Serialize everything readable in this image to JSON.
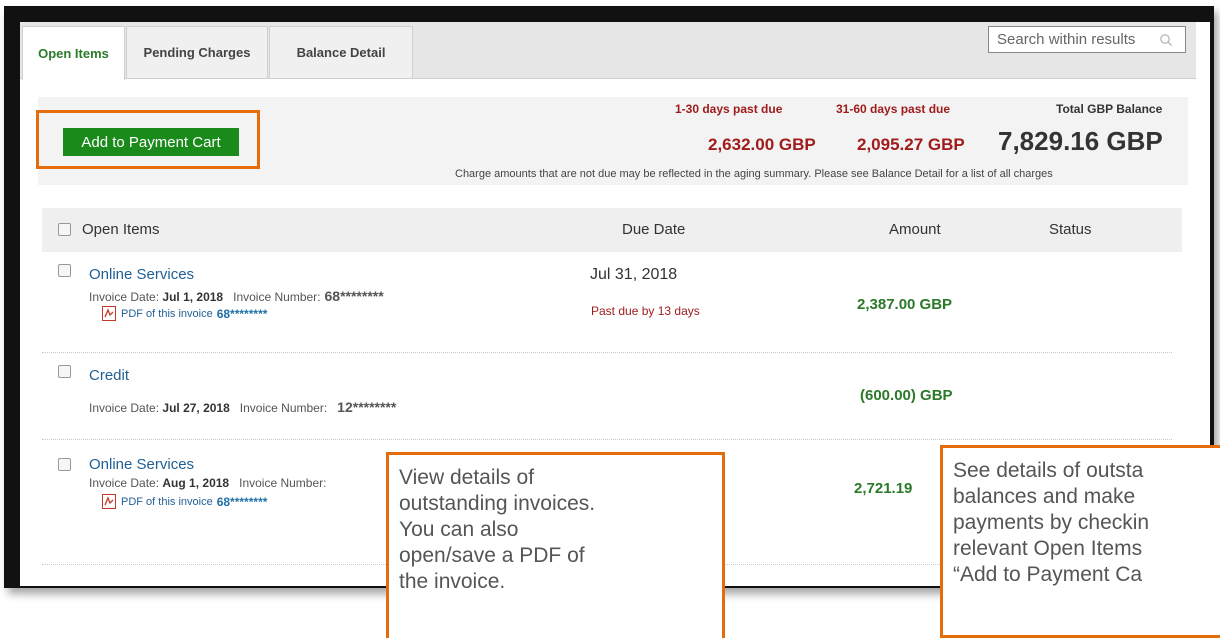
{
  "tabs": [
    {
      "label": "Open Items",
      "active": true
    },
    {
      "label": "Pending Charges",
      "active": false
    },
    {
      "label": "Balance Detail",
      "active": false
    }
  ],
  "search": {
    "placeholder": "Search within results"
  },
  "summary": {
    "pay_button_label": "Add to Payment Cart",
    "aging": [
      {
        "label": "1-30 days past due",
        "value": "2,632.00 GBP"
      },
      {
        "label": "31-60 days past due",
        "value": "2,095.27 GBP"
      }
    ],
    "total_label": "Total GBP Balance",
    "total_value": "7,829.16 GBP",
    "note": "Charge amounts that are not due may be reflected in the aging summary. Please see Balance Detail for a list of all charges"
  },
  "table": {
    "headers": {
      "items": "Open Items",
      "due": "Due Date",
      "amount": "Amount",
      "status": "Status"
    },
    "rows": [
      {
        "title": "Online Services",
        "invoice_date_label": "Invoice Date:",
        "invoice_date": "Jul 1, 2018",
        "invoice_number_label": "Invoice Number:",
        "invoice_number": "68********",
        "pdf_label": "PDF of this invoice",
        "pdf_number": "68********",
        "due_date": "Jul 31, 2018",
        "past_due": "Past due by 13 days",
        "amount": "2,387.00 GBP"
      },
      {
        "title": "Credit",
        "invoice_date_label": "Invoice Date:",
        "invoice_date": "Jul 27, 2018",
        "invoice_number_label": "Invoice Number:",
        "invoice_number": "12********",
        "amount": "(600.00) GBP"
      },
      {
        "title": "Online Services",
        "invoice_date_label": "Invoice Date:",
        "invoice_date": "Aug 1, 2018",
        "invoice_number_label": "Invoice Number:",
        "pdf_label": "PDF of this invoice",
        "pdf_number": "68********",
        "amount": "2,721.19"
      }
    ]
  },
  "callouts": {
    "left": [
      "View details of",
      "outstanding invoices.",
      "You can also",
      "open/save a PDF of",
      "the invoice."
    ],
    "right": [
      "See details of outsta",
      "balances and make",
      "payments by checkin",
      "relevant Open Items",
      "“Add to Payment Ca"
    ]
  },
  "colors": {
    "accent_green": "#1a8a1a",
    "past_due_red": "#a01c1c",
    "callout_orange": "#e46c0a",
    "link_blue": "#1f5f95"
  }
}
